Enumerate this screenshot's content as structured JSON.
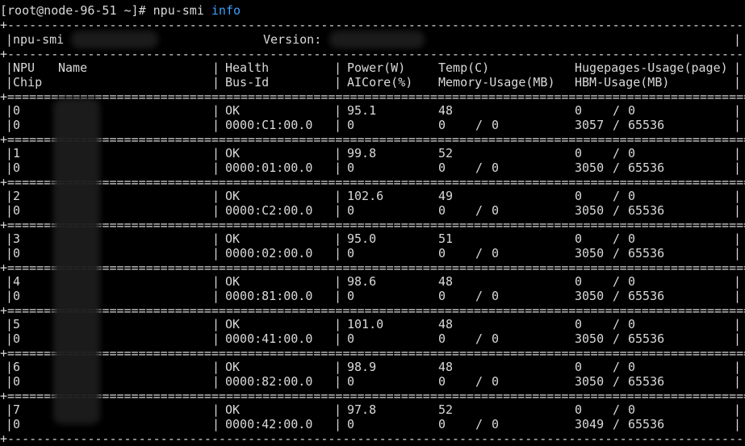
{
  "prompt": {
    "user_host": "[root@node-96-51 ~]#",
    "command": "npu-smi",
    "arg": "info"
  },
  "header": {
    "tool_label": "npu-smi",
    "version_label": "Version:"
  },
  "columns": {
    "c1_line1": "NPU",
    "c1_line2": "Chip",
    "c1b_line1": "Name",
    "c2_line1": "Health",
    "c2_line2": "Bus-Id",
    "c3_line1": "Power(W)",
    "c3_line2": "AICore(%)",
    "c4_line1": "Temp(C)",
    "c4_line2": "Memory-Usage(MB)",
    "c5_line1": "Hugepages-Usage(page)",
    "c5_line2": "HBM-Usage(MB)"
  },
  "rows": [
    {
      "npu": "0",
      "chip": "0",
      "health": "OK",
      "bus": "0000:C1:00.0",
      "power": "95.1",
      "aicore": "0",
      "temp": "48",
      "mem_used": "0",
      "mem_total": "0",
      "huge_used": "0",
      "huge_total": "0",
      "hbm_used": "3057",
      "hbm_total": "65536"
    },
    {
      "npu": "1",
      "chip": "0",
      "health": "OK",
      "bus": "0000:01:00.0",
      "power": "99.8",
      "aicore": "0",
      "temp": "52",
      "mem_used": "0",
      "mem_total": "0",
      "huge_used": "0",
      "huge_total": "0",
      "hbm_used": "3050",
      "hbm_total": "65536"
    },
    {
      "npu": "2",
      "chip": "0",
      "health": "OK",
      "bus": "0000:C2:00.0",
      "power": "102.6",
      "aicore": "0",
      "temp": "49",
      "mem_used": "0",
      "mem_total": "0",
      "huge_used": "0",
      "huge_total": "0",
      "hbm_used": "3050",
      "hbm_total": "65536"
    },
    {
      "npu": "3",
      "chip": "0",
      "health": "OK",
      "bus": "0000:02:00.0",
      "power": "95.0",
      "aicore": "0",
      "temp": "51",
      "mem_used": "0",
      "mem_total": "0",
      "huge_used": "0",
      "huge_total": "0",
      "hbm_used": "3050",
      "hbm_total": "65536"
    },
    {
      "npu": "4",
      "chip": "0",
      "health": "OK",
      "bus": "0000:81:00.0",
      "power": "98.6",
      "aicore": "0",
      "temp": "48",
      "mem_used": "0",
      "mem_total": "0",
      "huge_used": "0",
      "huge_total": "0",
      "hbm_used": "3050",
      "hbm_total": "65536"
    },
    {
      "npu": "5",
      "chip": "0",
      "health": "OK",
      "bus": "0000:41:00.0",
      "power": "101.0",
      "aicore": "0",
      "temp": "48",
      "mem_used": "0",
      "mem_total": "0",
      "huge_used": "0",
      "huge_total": "0",
      "hbm_used": "3050",
      "hbm_total": "65536"
    },
    {
      "npu": "6",
      "chip": "0",
      "health": "OK",
      "bus": "0000:82:00.0",
      "power": "98.9",
      "aicore": "0",
      "temp": "48",
      "mem_used": "0",
      "mem_total": "0",
      "huge_used": "0",
      "huge_total": "0",
      "hbm_used": "3050",
      "hbm_total": "65536"
    },
    {
      "npu": "7",
      "chip": "0",
      "health": "OK",
      "bus": "0000:42:00.0",
      "power": "97.8",
      "aicore": "0",
      "temp": "52",
      "mem_used": "0",
      "mem_total": "0",
      "huge_used": "0",
      "huge_total": "0",
      "hbm_used": "3049",
      "hbm_total": "65536"
    }
  ],
  "colors": {
    "background": "#000000",
    "text": "#d9d9d9",
    "command_arg": "#3aa0ff"
  }
}
